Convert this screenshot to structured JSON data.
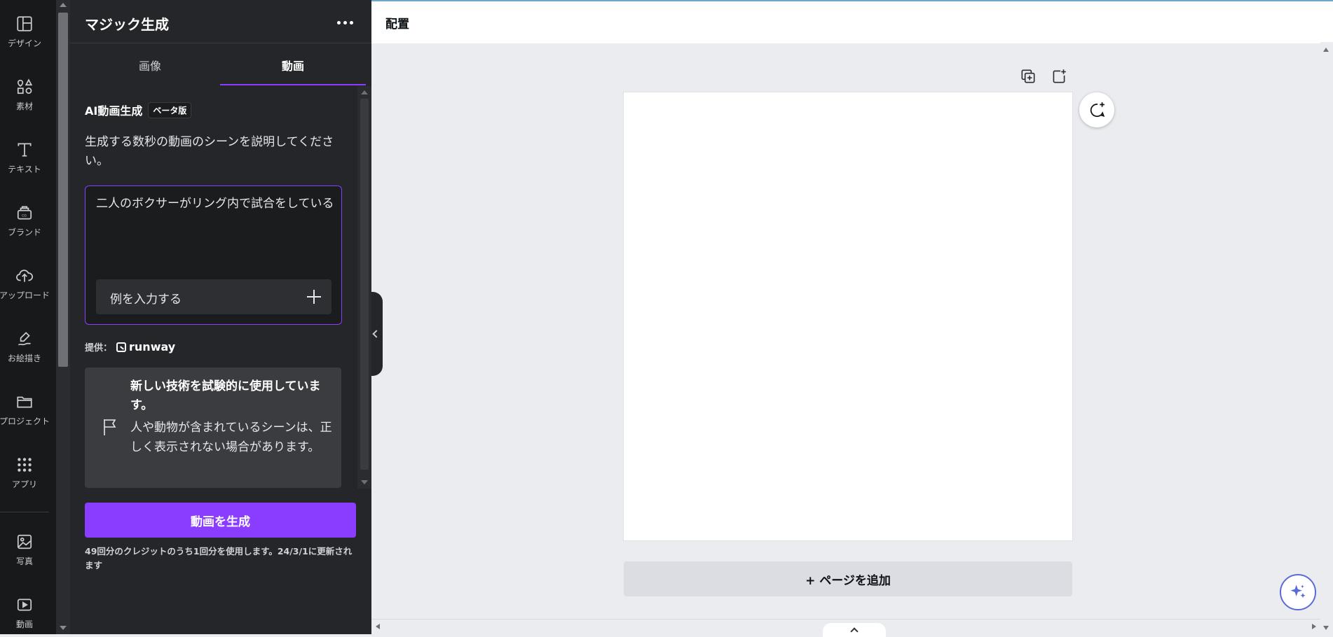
{
  "rail": {
    "items": [
      {
        "label": "デザイン",
        "icon": "layout-icon"
      },
      {
        "label": "素材",
        "icon": "shapes-icon"
      },
      {
        "label": "テキスト",
        "icon": "text-icon"
      },
      {
        "label": "ブランド",
        "icon": "brand-icon"
      },
      {
        "label": "アップロード",
        "icon": "upload-icon"
      },
      {
        "label": "お絵描き",
        "icon": "draw-icon"
      },
      {
        "label": "プロジェクト",
        "icon": "folder-icon"
      },
      {
        "label": "アプリ",
        "icon": "apps-icon"
      },
      {
        "label": "写真",
        "icon": "photo-icon"
      },
      {
        "label": "動画",
        "icon": "video-icon"
      }
    ]
  },
  "panel": {
    "title": "マジック生成",
    "tabs": [
      {
        "label": "画像",
        "active": false
      },
      {
        "label": "動画",
        "active": true
      }
    ],
    "section_title": "AI動画生成",
    "beta_badge": "ベータ版",
    "description": "生成する数秒の動画のシーンを説明してください。",
    "prompt_value": "二人のボクサーがリング内で試合をしている",
    "example_button": "例を入力する",
    "provider_label": "提供：",
    "provider_name": "runway",
    "notice_title": "新しい技術を試験的に使用しています。",
    "notice_body": "人や動物が含まれているシーンは、正しく表示されない場合があります。",
    "generate_button": "動画を生成",
    "credit_note": "49回分のクレジットのうち1回分を使用します。24/3/1に更新されます"
  },
  "topbar": {
    "arrange_label": "配置"
  },
  "canvas": {
    "add_page_label": "+ ページを追加"
  },
  "colors": {
    "accent": "#8b3dff",
    "rail_bg": "#18191b",
    "panel_bg": "#252629",
    "canvas_bg": "#ebecf0"
  }
}
